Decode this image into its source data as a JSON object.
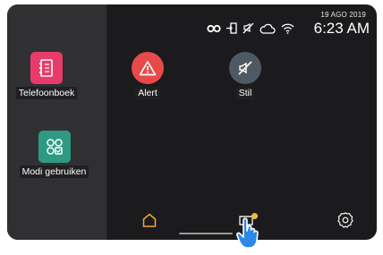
{
  "status_bar": {
    "date": "19 AGO 2019",
    "time": "6:23 AM",
    "icons": [
      "infinity-icon",
      "door-lock-icon",
      "mute-icon",
      "cloud-icon",
      "wifi-icon"
    ]
  },
  "apps": [
    {
      "label": "Telefoonboek",
      "icon": "phonebook-icon",
      "color": "#e83b6b"
    },
    {
      "label": "Alert",
      "icon": "alert-icon",
      "color": "#e84a4a"
    },
    {
      "label": "Stil",
      "icon": "silent-icon",
      "color": "#4e5a63"
    },
    {
      "label": "Modi gebruiken",
      "icon": "modes-icon",
      "color": "#2e9a84"
    }
  ],
  "nav": {
    "items": [
      "home-icon",
      "messages-icon",
      "settings-icon"
    ],
    "active_color": "#f2a531",
    "notification_color": "#f2b63a"
  }
}
